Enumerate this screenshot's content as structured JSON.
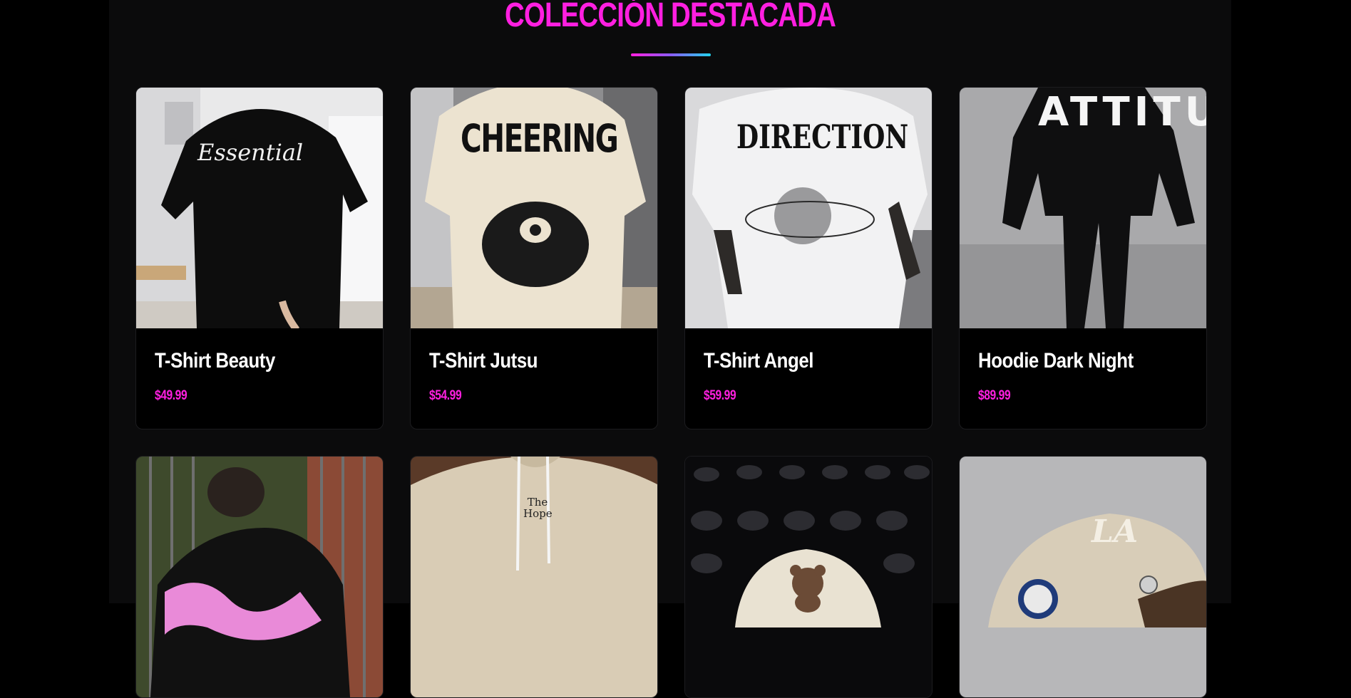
{
  "section": {
    "title": "COLECCIÓN DESTACADA",
    "accent_colors": [
      "#ff1fe0",
      "#8a5cf5",
      "#22d3ee"
    ]
  },
  "products": [
    {
      "name": "T-Shirt Beauty",
      "price": "$49.99",
      "image": "black-tshirt-essential-print",
      "print_text": "Essential"
    },
    {
      "name": "T-Shirt Jutsu",
      "price": "$54.99",
      "image": "cream-tshirt-cheering-print",
      "print_text": "CHEERING"
    },
    {
      "name": "T-Shirt Angel",
      "price": "$59.99",
      "image": "white-tshirt-direction-print",
      "print_text": "DIRECTION"
    },
    {
      "name": "Hoodie Dark Night",
      "price": "$89.99",
      "image": "black-hoodie-attitude-print",
      "print_text": "ATTITUD"
    },
    {
      "name": "",
      "price": "",
      "image": "black-hoodie-pink-graphic",
      "print_text": ""
    },
    {
      "name": "",
      "price": "",
      "image": "beige-hoodie-the-hope",
      "print_text": "The Hope"
    },
    {
      "name": "",
      "price": "",
      "image": "cream-cap-bear-patch",
      "print_text": ""
    },
    {
      "name": "",
      "price": "",
      "image": "beige-cap-la-logo",
      "print_text": "LA"
    }
  ]
}
